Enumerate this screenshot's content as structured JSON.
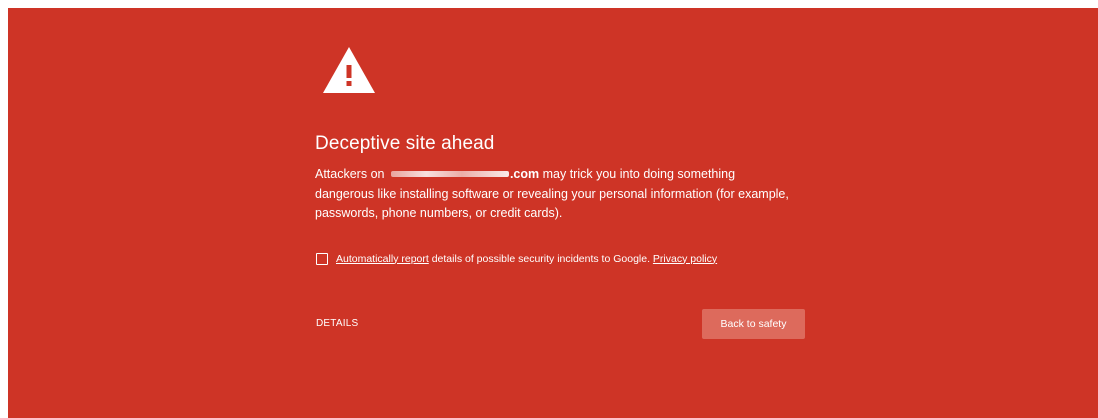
{
  "page": {
    "background_color": "#ce3426",
    "button_color": "#dd6a5c"
  },
  "warning": {
    "icon": "warning-triangle-icon",
    "title": "Deceptive site ahead",
    "desc_prefix": "Attackers on ",
    "domain_suffix": ".com",
    "desc_rest": " may trick you into doing something dangerous like installing software or revealing your personal information (for example, passwords, phone numbers, or credit cards)."
  },
  "report": {
    "checkbox_checked": false,
    "link_label": "Automatically report",
    "text": " details of possible security incidents to Google. ",
    "privacy_label": "Privacy policy"
  },
  "actions": {
    "details_label": "DETAILS",
    "back_label": "Back to safety"
  }
}
